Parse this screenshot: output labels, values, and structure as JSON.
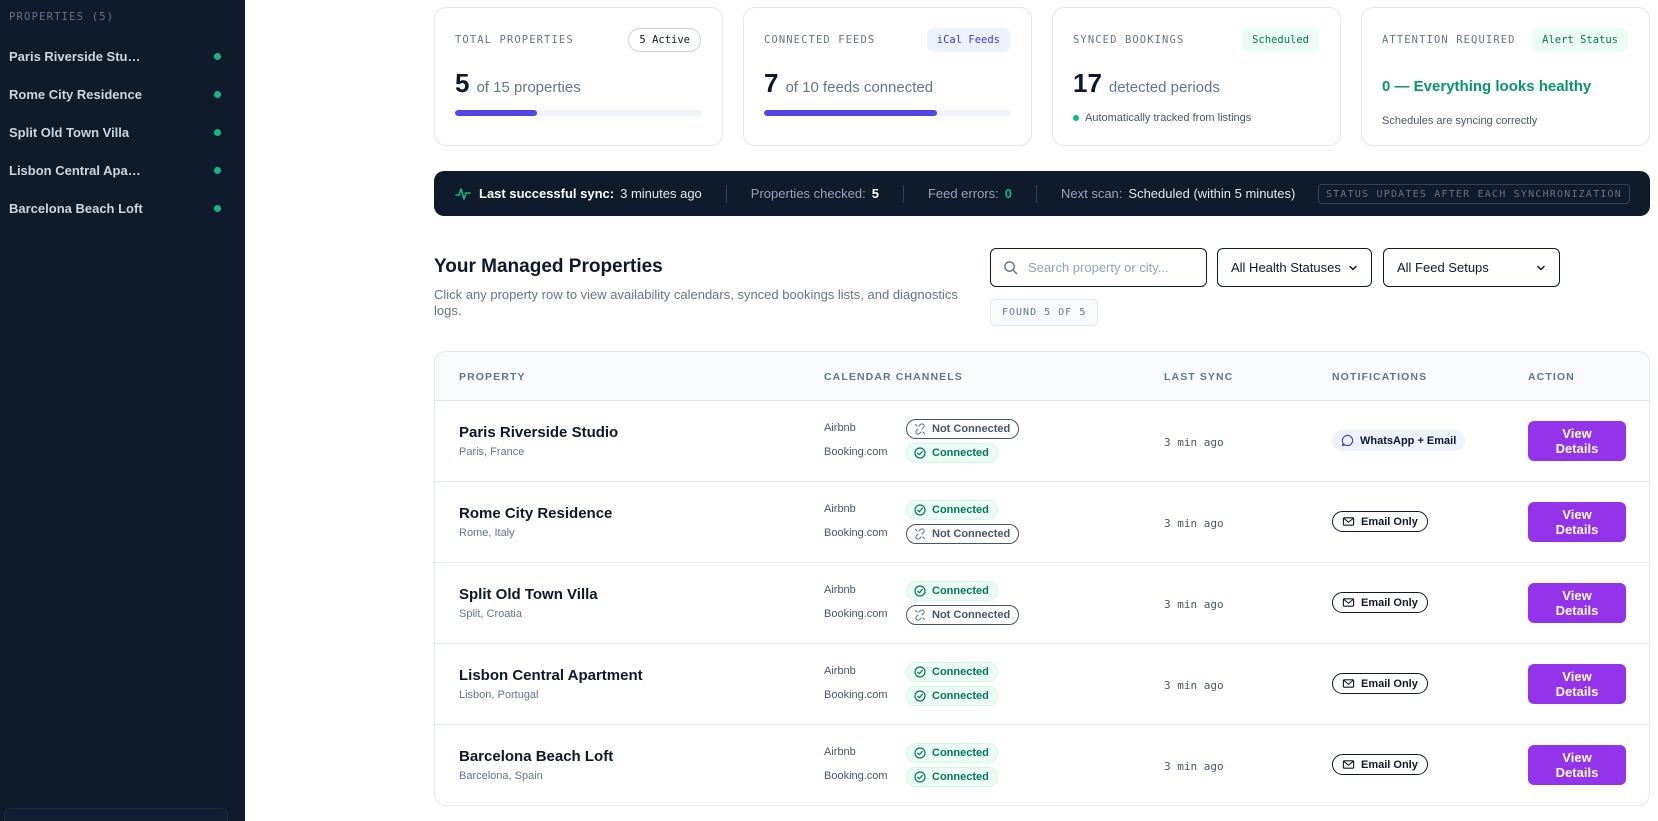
{
  "sidebar": {
    "heading": "PROPERTIES (5)",
    "items": [
      {
        "label": "Paris Riverside Studio",
        "status": "online"
      },
      {
        "label": "Rome City Residence",
        "status": "online"
      },
      {
        "label": "Split Old Town Villa",
        "status": "online"
      },
      {
        "label": "Lisbon Central Apart...",
        "status": "online"
      },
      {
        "label": "Barcelona Beach Loft",
        "status": "online"
      }
    ]
  },
  "stats": {
    "total": {
      "label": "TOTAL PROPERTIES",
      "badge": "5 Active",
      "value": "5",
      "sub": "of 15 properties",
      "progress": 0.333
    },
    "feeds": {
      "label": "CONNECTED FEEDS",
      "badge": "iCal Feeds",
      "value": "7",
      "sub": "of 10 feeds connected",
      "progress": 0.7
    },
    "bookings": {
      "label": "SYNCED BOOKINGS",
      "badge": "Scheduled",
      "value": "17",
      "sub": "detected periods",
      "note": "Automatically tracked from listings"
    },
    "attention": {
      "label": "ATTENTION REQUIRED",
      "badge": "Alert Status",
      "headline": "0 — Everything looks healthy",
      "note": "Schedules are syncing correctly"
    }
  },
  "sync_bar": {
    "last_sync_label": "Last successful sync:",
    "last_sync_value": "3 minutes ago",
    "checked_label": "Properties checked:",
    "checked_value": "5",
    "errors_label": "Feed errors:",
    "errors_value": "0",
    "next_label": "Next scan:",
    "next_value": "Scheduled (within 5 minutes)",
    "tag": "STATUS UPDATES AFTER EACH SYNCHRONIZATION"
  },
  "section": {
    "title": "Your Managed Properties",
    "description": "Click any property row to view availability calendars, synced bookings lists, and diagnostics logs."
  },
  "filters": {
    "search_placeholder": "Search property or city...",
    "health_select": "All Health Statuses",
    "feed_select": "All Feed Setups",
    "found": "FOUND 5 OF 5"
  },
  "table": {
    "headers": {
      "property": "PROPERTY",
      "channels": "CALENDAR CHANNELS",
      "last_sync": "LAST SYNC",
      "notifications": "NOTIFICATIONS",
      "action": "ACTION"
    },
    "channel_names": {
      "airbnb": "Airbnb",
      "booking": "Booking.com"
    },
    "status_labels": {
      "on": "Connected",
      "off": "Not Connected"
    },
    "action_label": "View Details",
    "rows": [
      {
        "name": "Paris Riverside Studio",
        "city": "Paris, France",
        "airbnb": false,
        "booking": true,
        "last_sync": "3 min ago",
        "notification": "WhatsApp + Email",
        "notif_type": "whatsapp"
      },
      {
        "name": "Rome City Residence",
        "city": "Rome, Italy",
        "airbnb": true,
        "booking": false,
        "last_sync": "3 min ago",
        "notification": "Email Only",
        "notif_type": "email"
      },
      {
        "name": "Split Old Town Villa",
        "city": "Split, Croatia",
        "airbnb": true,
        "booking": false,
        "last_sync": "3 min ago",
        "notification": "Email Only",
        "notif_type": "email"
      },
      {
        "name": "Lisbon Central Apartment",
        "city": "Lisbon, Portugal",
        "airbnb": true,
        "booking": true,
        "last_sync": "3 min ago",
        "notification": "Email Only",
        "notif_type": "email"
      },
      {
        "name": "Barcelona Beach Loft",
        "city": "Barcelona, Spain",
        "airbnb": true,
        "booking": true,
        "last_sync": "3 min ago",
        "notification": "Email Only",
        "notif_type": "email"
      }
    ]
  },
  "colors": {
    "sidebar_bg": "#0f1a2b",
    "accent_purple": "#9333ea",
    "accent_indigo": "#4f46e5",
    "success_green": "#10b981"
  }
}
